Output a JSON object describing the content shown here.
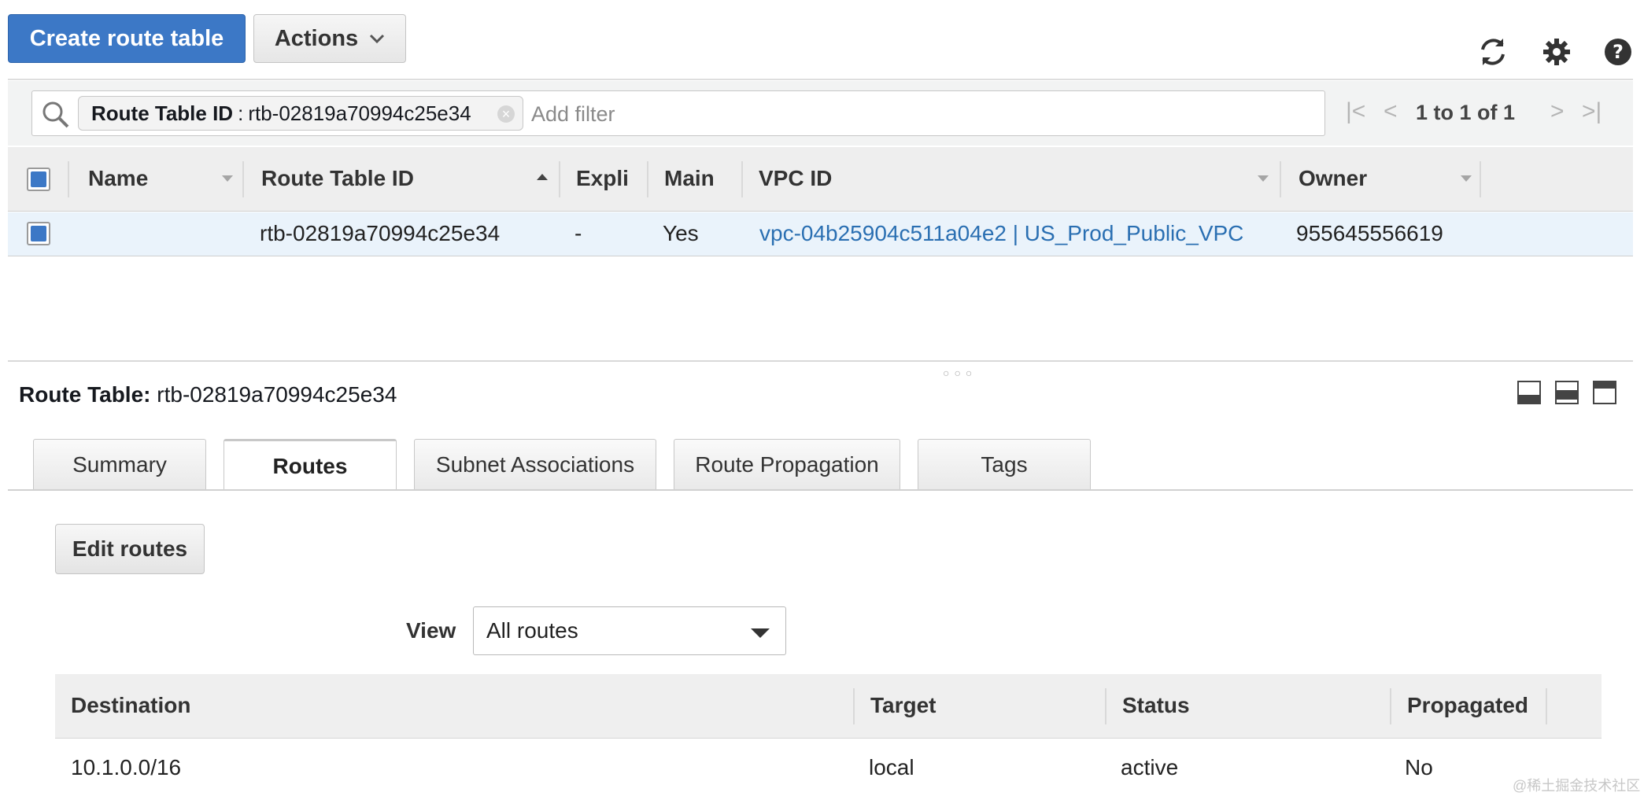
{
  "toolbar": {
    "create_label": "Create route table",
    "actions_label": "Actions",
    "icons": [
      "refresh-icon",
      "gear-icon",
      "help-icon"
    ]
  },
  "filter": {
    "token_key": "Route Table ID",
    "token_sep": ":",
    "token_value": "rtb-02819a70994c25e34",
    "placeholder": "Add filter",
    "pagination": "1 to 1 of 1"
  },
  "grid": {
    "columns": [
      "Name",
      "Route Table ID",
      "Expli",
      "Main",
      "VPC ID",
      "Owner"
    ],
    "sort_column": "Route Table ID",
    "rows": [
      {
        "selected": true,
        "name": "",
        "route_table_id": "rtb-02819a70994c25e34",
        "explicit": "-",
        "main": "Yes",
        "vpc_id": "vpc-04b25904c511a04e2 | US_Prod_Public_VPC",
        "owner": "955645556619"
      }
    ]
  },
  "detail": {
    "title_label": "Route Table:",
    "title_value": "rtb-02819a70994c25e34",
    "tabs": [
      "Summary",
      "Routes",
      "Subnet Associations",
      "Route Propagation",
      "Tags"
    ],
    "active_tab": "Routes",
    "edit_routes_label": "Edit routes",
    "view_label": "View",
    "view_selected": "All routes",
    "routes_columns": [
      "Destination",
      "Target",
      "Status",
      "Propagated"
    ],
    "routes": [
      {
        "destination": "10.1.0.0/16",
        "target": "local",
        "status": "active",
        "propagated": "No"
      }
    ]
  },
  "watermark": "@稀土掘金技术社区",
  "colors": {
    "primary": "#3c78c6",
    "link": "#2a6fb2",
    "selected_row": "#eaf3fb"
  }
}
